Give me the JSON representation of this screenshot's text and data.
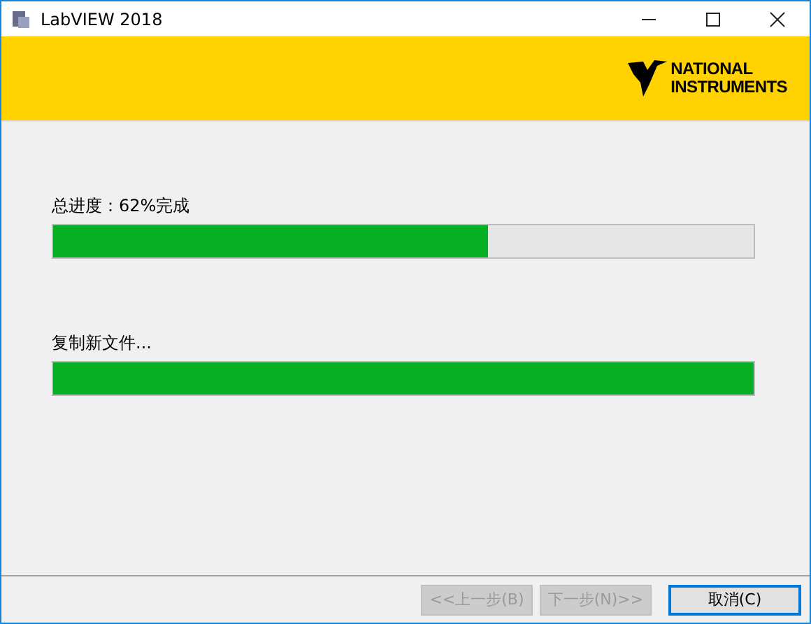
{
  "window": {
    "title": "LabVIEW 2018"
  },
  "banner": {
    "logo_line_1": "NATIONAL",
    "logo_line_2": "INSTRUMENTS"
  },
  "progress": [
    {
      "label": "总进度：62%完成",
      "level": 0.62
    },
    {
      "label": "复制新文件...",
      "level": 1
    }
  ],
  "buttons": [
    {
      "label": "<<上一步(B)",
      "disabled": true,
      "default": false
    },
    {
      "label": "下一步(N)>>",
      "disabled": true,
      "default": false
    },
    {
      "label": "取消(C)",
      "disabled": false,
      "default": true
    }
  ]
}
